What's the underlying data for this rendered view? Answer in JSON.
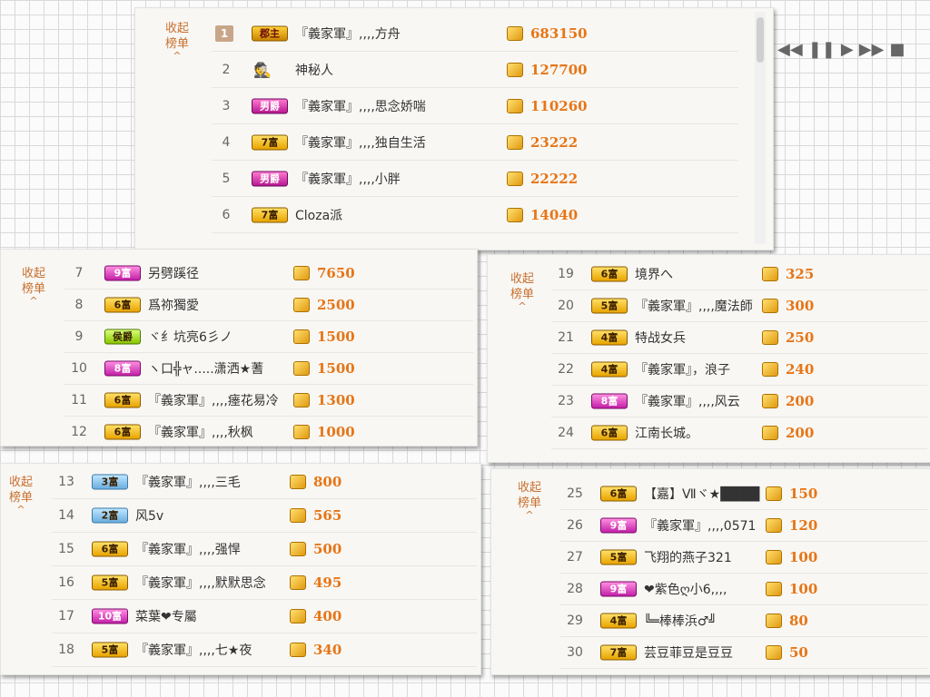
{
  "ui": {
    "collapse_label_1": "收起",
    "collapse_label_2": "榜单"
  },
  "media_controls": [
    {
      "name": "rewind-icon",
      "glyph": "◀◀"
    },
    {
      "name": "pause-icon",
      "glyph": "❚❚"
    },
    {
      "name": "play-icon",
      "glyph": "▶"
    },
    {
      "name": "fast-forward-icon",
      "glyph": "▶▶"
    },
    {
      "name": "stop-icon",
      "glyph": "■"
    }
  ],
  "panels": [
    {
      "rows": [
        {
          "rank": "1",
          "badge": "郡主",
          "badge_style": "duke",
          "name": "『義家軍』,,,,方舟",
          "score": "683150"
        },
        {
          "rank": "2",
          "badge": "",
          "badge_style": "spy",
          "name": "神秘人",
          "score": "127700"
        },
        {
          "rank": "3",
          "badge": "男爵",
          "badge_style": "count",
          "name": "『義家軍』,,,,思念娇喘",
          "score": "110260"
        },
        {
          "rank": "4",
          "badge": "7富",
          "badge_style": "gold",
          "name": "『義家軍』,,,,独自生活",
          "score": "23222"
        },
        {
          "rank": "5",
          "badge": "男爵",
          "badge_style": "count",
          "name": "『義家軍』,,,,小胖",
          "score": "22222"
        },
        {
          "rank": "6",
          "badge": "7富",
          "badge_style": "gold",
          "name": "Cloza派",
          "score": "14040"
        }
      ]
    },
    {
      "rows": [
        {
          "rank": "7",
          "badge": "9富",
          "badge_style": "pink",
          "name": "另劈蹊径",
          "score": "7650"
        },
        {
          "rank": "8",
          "badge": "6富",
          "badge_style": "gold",
          "name": "爲祢獨愛",
          "score": "2500"
        },
        {
          "rank": "9",
          "badge": "侯爵",
          "badge_style": "green",
          "name": "ヾ纟坑亮6彡ノ",
          "score": "1500"
        },
        {
          "rank": "10",
          "badge": "8富",
          "badge_style": "pink",
          "name": "ヽ口╬ャ.....潇洒★蓍",
          "score": "1500"
        },
        {
          "rank": "11",
          "badge": "6富",
          "badge_style": "gold",
          "name": "『義家軍』,,,,瘗花易冷",
          "score": "1300"
        },
        {
          "rank": "12",
          "badge": "6富",
          "badge_style": "gold",
          "name": "『義家軍』,,,,秋枫",
          "score": "1000"
        }
      ]
    },
    {
      "rows": [
        {
          "rank": "19",
          "badge": "6富",
          "badge_style": "gold",
          "name": "境界へ",
          "score": "325"
        },
        {
          "rank": "20",
          "badge": "5富",
          "badge_style": "gold",
          "name": "『義家軍』,,,,魔法師",
          "score": "300"
        },
        {
          "rank": "21",
          "badge": "4富",
          "badge_style": "gold",
          "name": "特战女兵",
          "score": "250"
        },
        {
          "rank": "22",
          "badge": "4富",
          "badge_style": "gold",
          "name": "『義家軍』，浪子",
          "score": "240"
        },
        {
          "rank": "23",
          "badge": "8富",
          "badge_style": "pink",
          "name": "『義家軍』,,,,风云",
          "score": "200"
        },
        {
          "rank": "24",
          "badge": "6富",
          "badge_style": "gold",
          "name": "江南长城。",
          "score": "200"
        }
      ]
    },
    {
      "rows": [
        {
          "rank": "13",
          "badge": "3富",
          "badge_style": "blue",
          "name": "『義家軍』,,,,三毛",
          "score": "800"
        },
        {
          "rank": "14",
          "badge": "2富",
          "badge_style": "blue",
          "name": "风5v",
          "score": "565"
        },
        {
          "rank": "15",
          "badge": "6富",
          "badge_style": "gold",
          "name": "『義家軍』,,,,强悍",
          "score": "500"
        },
        {
          "rank": "16",
          "badge": "5富",
          "badge_style": "gold",
          "name": "『義家軍』,,,,默默思念",
          "score": "495"
        },
        {
          "rank": "17",
          "badge": "10富",
          "badge_style": "pink",
          "name": "菜葉❤专屬",
          "score": "400"
        },
        {
          "rank": "18",
          "badge": "5富",
          "badge_style": "gold",
          "name": "『義家軍』,,,,七★夜",
          "score": "340"
        }
      ]
    },
    {
      "rows": [
        {
          "rank": "25",
          "badge": "6富",
          "badge_style": "gold",
          "name": "【嘉】Ⅶヾ★████",
          "score": "150"
        },
        {
          "rank": "26",
          "badge": "9富",
          "badge_style": "pink",
          "name": "『義家軍』,,,,0571",
          "score": "120"
        },
        {
          "rank": "27",
          "badge": "5富",
          "badge_style": "gold",
          "name": "飞翔的燕子321",
          "score": "100"
        },
        {
          "rank": "28",
          "badge": "9富",
          "badge_style": "pink",
          "name": "❤紫色ღ小6,,,,",
          "score": "100"
        },
        {
          "rank": "29",
          "badge": "4富",
          "badge_style": "gold",
          "name": "╚═棒棒浜♂╝",
          "score": "80"
        },
        {
          "rank": "30",
          "badge": "7富",
          "badge_style": "gold",
          "name": "芸豆菲豆是豆豆",
          "score": "50"
        }
      ]
    }
  ]
}
